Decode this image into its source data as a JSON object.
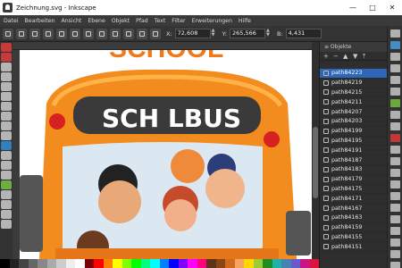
{
  "window": {
    "title": "Zeichnung.svg - Inkscape",
    "minimize": "—",
    "maximize": "□",
    "close": "✕"
  },
  "menu": [
    "Datei",
    "Bearbeiten",
    "Ansicht",
    "Ebene",
    "Objekt",
    "Pfad",
    "Text",
    "Filter",
    "Erweiterungen",
    "Hilfe"
  ],
  "toolcontrols": {
    "x_label": "X:",
    "x_value": "72,608",
    "y_label": "Y:",
    "y_value": "265,566",
    "w_label": "B:",
    "w_value": "4,431"
  },
  "canvas": {
    "bus_sign_text": "SCH  LBUS",
    "top_text": "SCHOOL"
  },
  "objects_panel": {
    "header": "≡ Objekte",
    "items": [
      {
        "label": "path84223",
        "selected": true
      },
      {
        "label": "path84219",
        "selected": false
      },
      {
        "label": "path84215",
        "selected": false
      },
      {
        "label": "path84211",
        "selected": false
      },
      {
        "label": "path84207",
        "selected": false
      },
      {
        "label": "path84203",
        "selected": false
      },
      {
        "label": "path84199",
        "selected": false
      },
      {
        "label": "path84195",
        "selected": false
      },
      {
        "label": "path84191",
        "selected": false
      },
      {
        "label": "path84187",
        "selected": false
      },
      {
        "label": "path84183",
        "selected": false
      },
      {
        "label": "path84179",
        "selected": false
      },
      {
        "label": "path84175",
        "selected": false
      },
      {
        "label": "path84171",
        "selected": false
      },
      {
        "label": "path84167",
        "selected": false
      },
      {
        "label": "path84163",
        "selected": false
      },
      {
        "label": "path84159",
        "selected": false
      },
      {
        "label": "path84155",
        "selected": false
      },
      {
        "label": "path84151",
        "selected": false
      }
    ]
  },
  "tools": [
    "#e33b3b",
    "#e33b3b",
    "#cccccc",
    "#cccccc",
    "#cccccc",
    "#cccccc",
    "#cccccc",
    "#cccccc",
    "#cccccc",
    "#cccccc",
    "#2e8fd6",
    "#cccccc",
    "#cccccc",
    "#cccccc",
    "#7ac443",
    "#cccccc",
    "#cccccc",
    "#cccccc",
    "#cccccc"
  ],
  "palette": [
    "#000000",
    "#222222",
    "#444444",
    "#666666",
    "#888888",
    "#aaaaaa",
    "#cccccc",
    "#eeeeee",
    "#ffffff",
    "#7f0000",
    "#ff0000",
    "#ff7f00",
    "#ffff00",
    "#7fff00",
    "#00ff00",
    "#00ff7f",
    "#00ffff",
    "#007fff",
    "#0000ff",
    "#7f00ff",
    "#ff00ff",
    "#ff007f",
    "#5c3317",
    "#8b4513",
    "#d2691e",
    "#f4a460",
    "#ffd700",
    "#9acd32",
    "#228b22",
    "#20b2aa",
    "#4682b4",
    "#6a5acd",
    "#c71585",
    "#dc143c"
  ],
  "commands": [
    "#cfcfcf",
    "#4aa3e6",
    "#cfcfcf",
    "#cfcfcf",
    "#cfcfcf",
    "#cfcfcf",
    "#7ac443",
    "#cfcfcf",
    "#cfcfcf",
    "#e33b3b",
    "#cfcfcf",
    "#cfcfcf",
    "#cfcfcf",
    "#cfcfcf",
    "#cfcfcf",
    "#cfcfcf",
    "#cfcfcf",
    "#cfcfcf",
    "#cfcfcf",
    "#cfcfcf",
    "#cfcfcf"
  ]
}
